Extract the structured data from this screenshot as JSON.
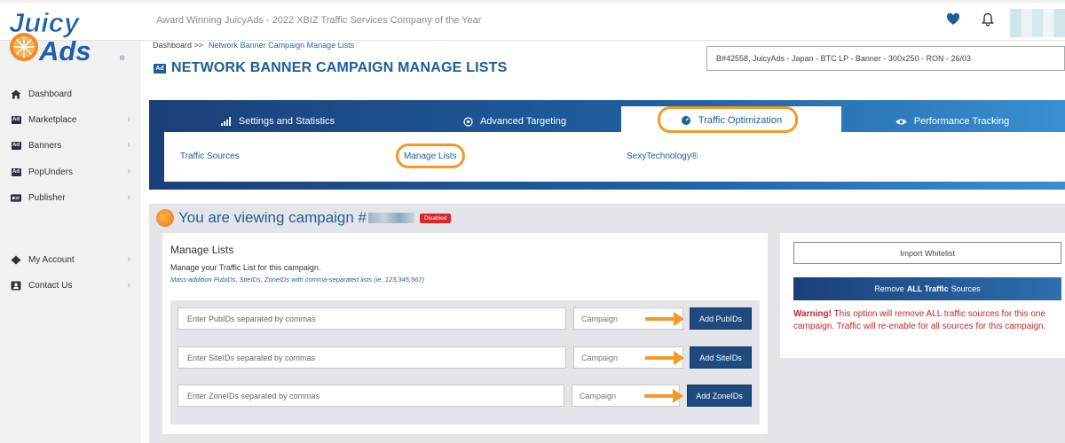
{
  "header": {
    "logo_top": "Juicy",
    "logo_bottom": "Ads",
    "award_text": "Award Winning JuicyAds - 2022 XBIZ Traffic Services Company of the Year"
  },
  "sidebar": {
    "items": [
      {
        "label": "Dashboard",
        "icon": "home-icon"
      },
      {
        "label": "Marketplace",
        "icon": "ad-icon"
      },
      {
        "label": "Banners",
        "icon": "ad-icon"
      },
      {
        "label": "PopUnders",
        "icon": "ad-icon"
      },
      {
        "label": "Publisher",
        "icon": "publisher-icon"
      },
      {
        "label": "My Account",
        "icon": "diamond-icon"
      },
      {
        "label": "Contact Us",
        "icon": "contact-icon"
      }
    ]
  },
  "breadcrumb": {
    "root": "Dashboard >>",
    "current": "Network Banner Campaign Manage Lists"
  },
  "page": {
    "title_badge": "Ad",
    "title": "NETWORK BANNER CAMPAIGN MANAGE LISTS",
    "campaign_select": "B#42558, JuicyAds - Japan - BTC LP - Banner - 300x250 - RON - 26/03"
  },
  "tabs": [
    {
      "label": "Settings and Statistics"
    },
    {
      "label": "Advanced Targeting"
    },
    {
      "label": "Traffic Optimization"
    },
    {
      "label": "Performance Tracking"
    }
  ],
  "subtabs": [
    {
      "label": "Traffic Sources"
    },
    {
      "label": "Manage Lists"
    },
    {
      "label": "SexyTechnology®"
    }
  ],
  "campaign_view": {
    "prefix": "You are viewing campaign #",
    "status": "Disabled"
  },
  "manage_lists": {
    "title": "Manage Lists",
    "description": "Manage your Traffic List for this campaign.",
    "note": "Mass-addition PubIDs, SiteIDs, ZoneIDs with comma-separated lists (ie. 123,345,567)",
    "rows": [
      {
        "placeholder": "Enter PubIDs separated by commas",
        "campaign": "Campaign",
        "button": "Add PubIDs"
      },
      {
        "placeholder": "Enter SiteIDs separated by commas",
        "campaign": "Campaign",
        "button": "Add SiteIDs"
      },
      {
        "placeholder": "Enter ZoneIDs separated by commas",
        "campaign": "Campaign",
        "button": "Add ZoneIDs"
      }
    ]
  },
  "right_panel": {
    "import_button": "Import Whitelist",
    "remove_pre": "Remove",
    "remove_bold": "ALL Traffic",
    "remove_post": "Sources",
    "warning_label": "Warning!",
    "warning_text": "This option will remove ALL traffic sources for this one campaign. Traffic will re-enable for all sources for this campaign."
  },
  "colors": {
    "brand_blue": "#1f5d9a",
    "highlight_orange": "#f39a26",
    "status_red": "#d9262b"
  }
}
